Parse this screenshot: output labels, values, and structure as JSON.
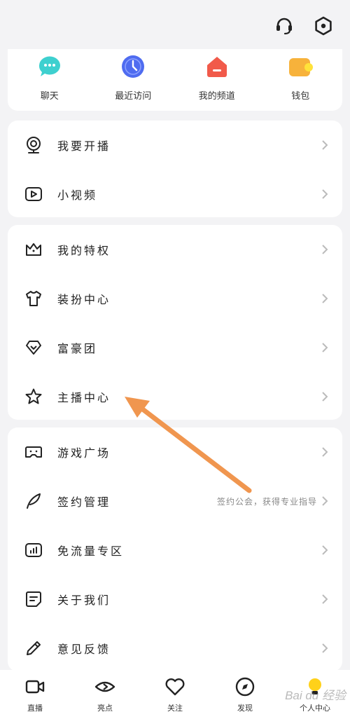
{
  "quick_actions": [
    {
      "label": "聊天",
      "icon": "chat-bubble-icon",
      "color": "#3ed0cf"
    },
    {
      "label": "最近访问",
      "icon": "clock-icon",
      "color": "#4f6cf0"
    },
    {
      "label": "我的频道",
      "icon": "channel-house-icon",
      "color": "#f15a4a"
    },
    {
      "label": "钱包",
      "icon": "wallet-icon",
      "color": "#f7b23b"
    }
  ],
  "group1": [
    {
      "label": "我要开播",
      "icon": "webcam-icon"
    },
    {
      "label": "小视频",
      "icon": "video-play-icon"
    }
  ],
  "group2": [
    {
      "label": "我的特权",
      "icon": "crown-icon"
    },
    {
      "label": "装扮中心",
      "icon": "tshirt-icon"
    },
    {
      "label": "富豪团",
      "icon": "diamond-icon"
    },
    {
      "label": "主播中心",
      "icon": "star-icon"
    }
  ],
  "group3": [
    {
      "label": "游戏广场",
      "icon": "gamepad-icon"
    },
    {
      "label": "签约管理",
      "icon": "feather-icon",
      "hint": "签约公会，获得专业指导"
    },
    {
      "label": "免流量专区",
      "icon": "signal-card-icon"
    },
    {
      "label": "关于我们",
      "icon": "note-icon"
    },
    {
      "label": "意见反馈",
      "icon": "pencil-icon"
    }
  ],
  "bottom_nav": [
    {
      "label": "直播",
      "icon": "camera-icon"
    },
    {
      "label": "亮点",
      "icon": "eye-icon"
    },
    {
      "label": "关注",
      "icon": "heart-icon"
    },
    {
      "label": "发现",
      "icon": "compass-icon"
    },
    {
      "label": "个人中心",
      "icon": "bulb-icon",
      "active": true
    }
  ],
  "watermark": "Bai du 经验",
  "colors": {
    "annotation_arrow": "#f0964f",
    "active_tab": "#ffd11a"
  }
}
